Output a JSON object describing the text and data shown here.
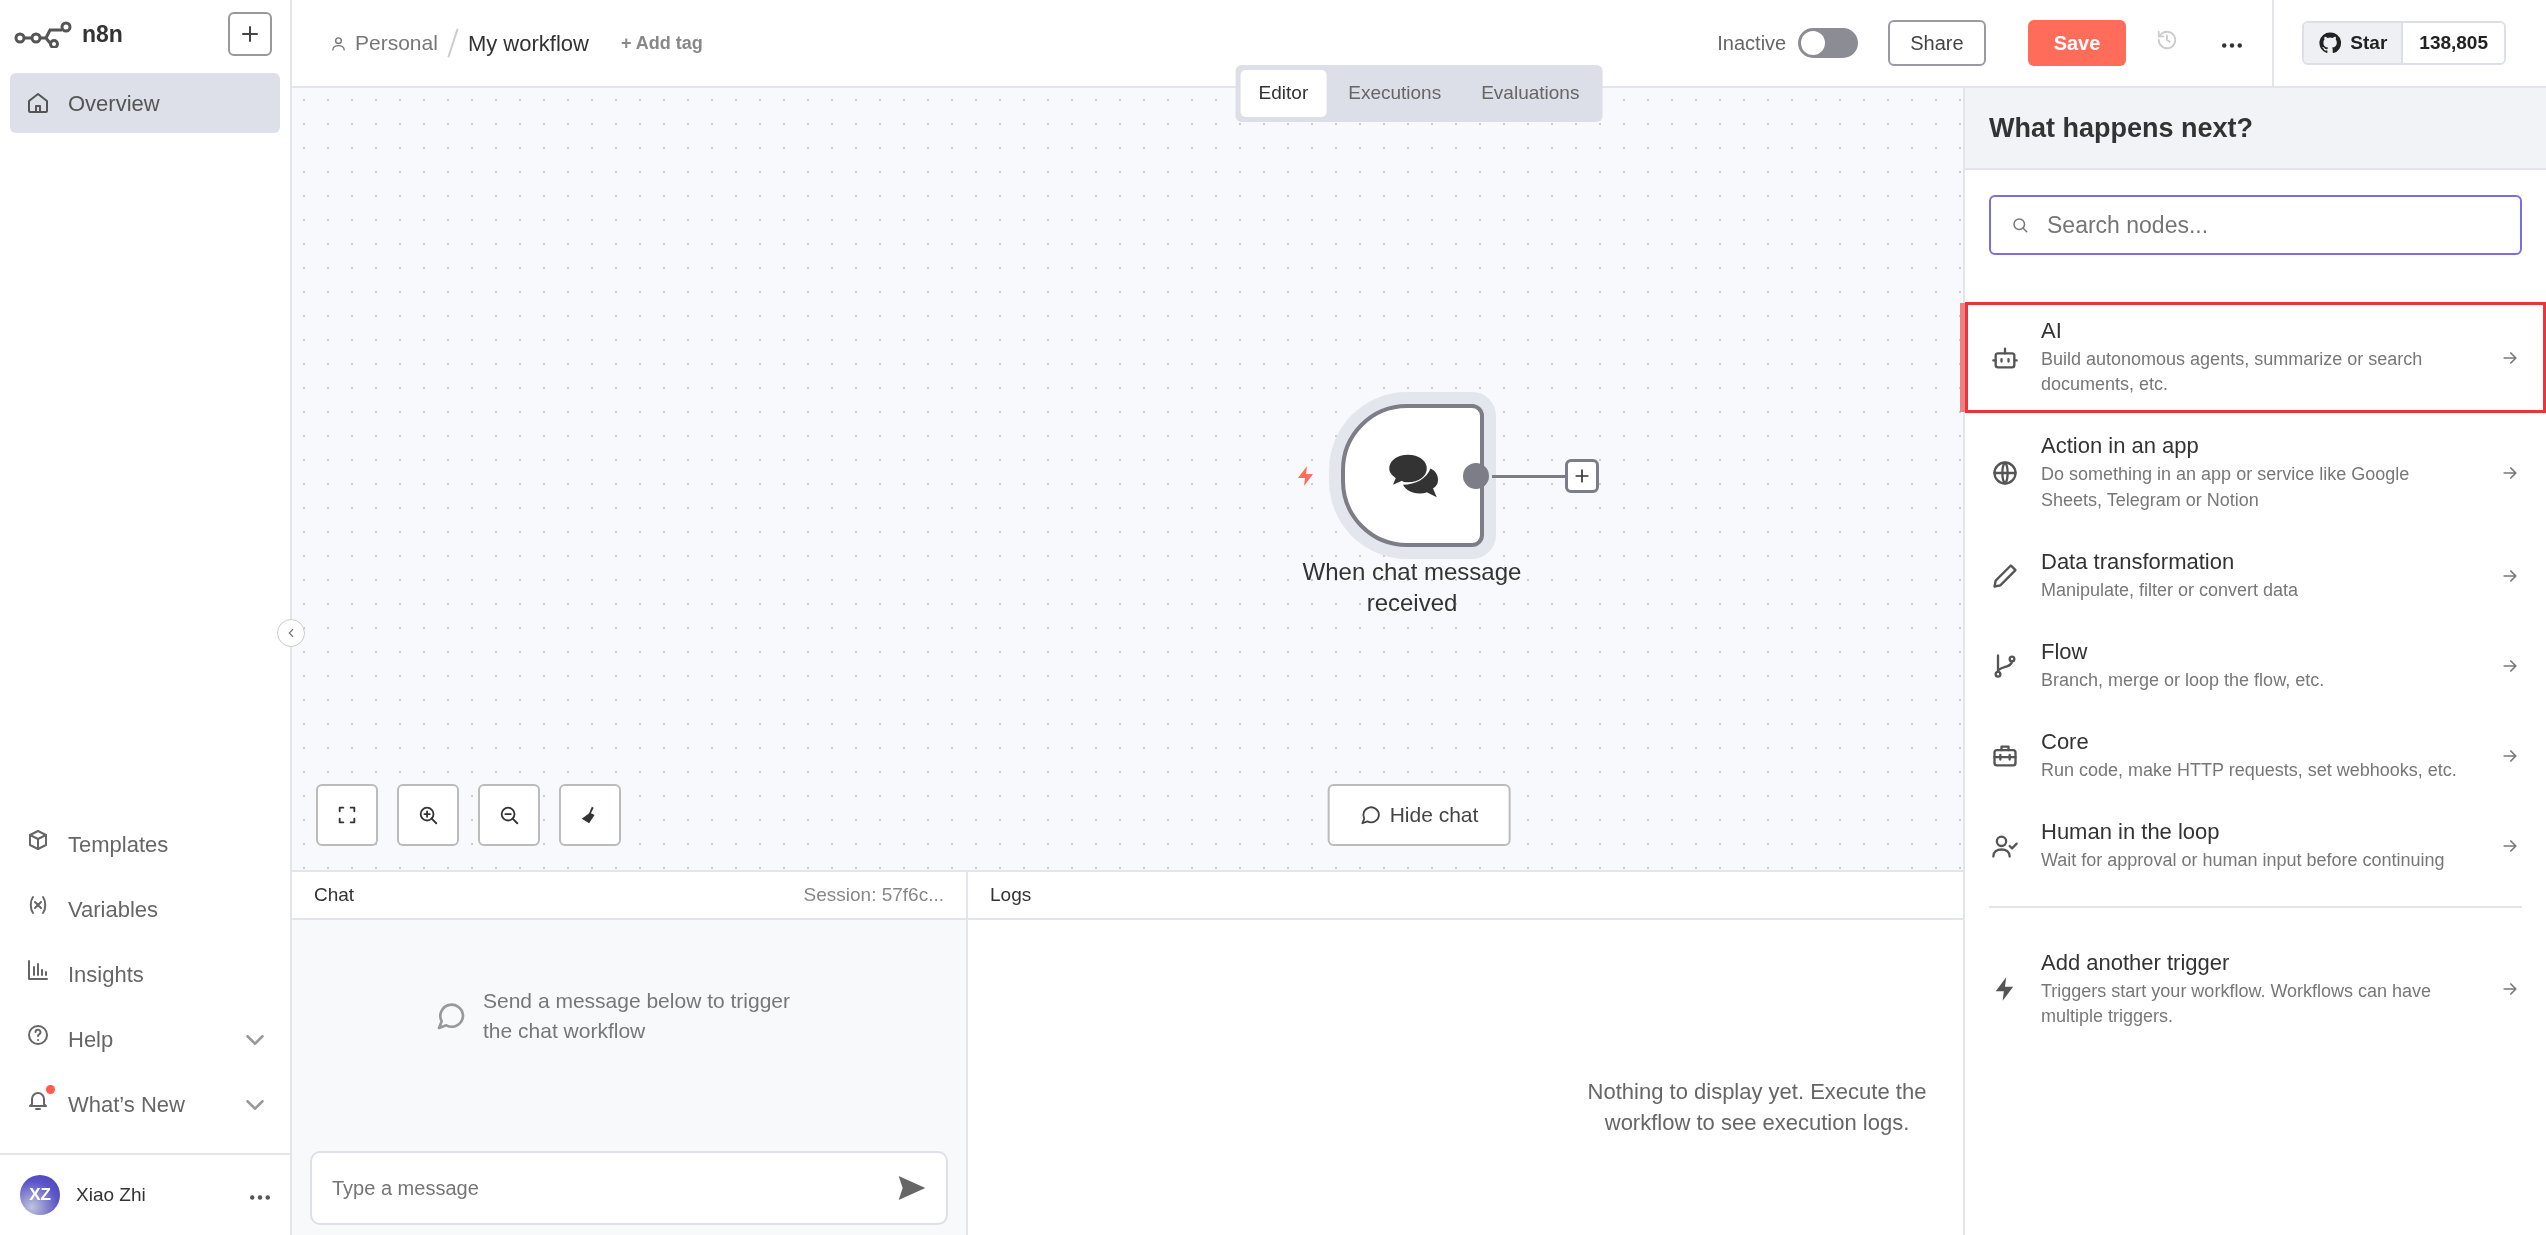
{
  "app": {
    "name": "n8n"
  },
  "sidebar": {
    "items": [
      {
        "label": "Overview",
        "selected": true
      }
    ],
    "bottom_items": [
      {
        "label": "Templates",
        "expandable": false,
        "notification": false
      },
      {
        "label": "Variables",
        "expandable": false,
        "notification": false
      },
      {
        "label": "Insights",
        "expandable": false,
        "notification": false
      },
      {
        "label": "Help",
        "expandable": true,
        "notification": false
      },
      {
        "label": "What’s New",
        "expandable": true,
        "notification": true
      }
    ],
    "user": {
      "initials": "XZ",
      "name": "Xiao Zhi"
    }
  },
  "header": {
    "project": "Personal",
    "workflow": "My workflow",
    "add_tag": "+ Add tag",
    "status": {
      "label": "Inactive",
      "on": false
    },
    "share": "Share",
    "save": "Save",
    "github": {
      "label": "Star",
      "count": "138,805"
    }
  },
  "view_tabs": [
    {
      "label": "Editor",
      "selected": true
    },
    {
      "label": "Executions",
      "selected": false
    },
    {
      "label": "Evaluations",
      "selected": false
    }
  ],
  "canvas": {
    "node": {
      "label": "When chat message received"
    },
    "hide_chat": "Hide chat"
  },
  "chat": {
    "title": "Chat",
    "session": "Session: 57f6c...",
    "empty_message": "Send a message below to trigger the chat workflow",
    "input": {
      "placeholder": "Type a message"
    }
  },
  "logs": {
    "title": "Logs",
    "empty_message": "Nothing to display yet. Execute the workflow to see execution logs."
  },
  "node_panel": {
    "title": "What happens next?",
    "search": {
      "placeholder": "Search nodes..."
    },
    "items": [
      {
        "title": "AI",
        "description": "Build autonomous agents, summarize or search documents, etc.",
        "selected": true
      },
      {
        "title": "Action in an app",
        "description": "Do something in an app or service like Google Sheets, Telegram or Notion",
        "selected": false
      },
      {
        "title": "Data transformation",
        "description": "Manipulate, filter or convert data",
        "selected": false
      },
      {
        "title": "Flow",
        "description": "Branch, merge or loop the flow, etc.",
        "selected": false
      },
      {
        "title": "Core",
        "description": "Run code, make HTTP requests, set webhooks, etc.",
        "selected": false
      },
      {
        "title": "Human in the loop",
        "description": "Wait for approval or human input before continuing",
        "selected": false
      }
    ],
    "trigger": {
      "title": "Add another trigger",
      "description": "Triggers start your workflow. Workflows can have multiple triggers."
    }
  }
}
